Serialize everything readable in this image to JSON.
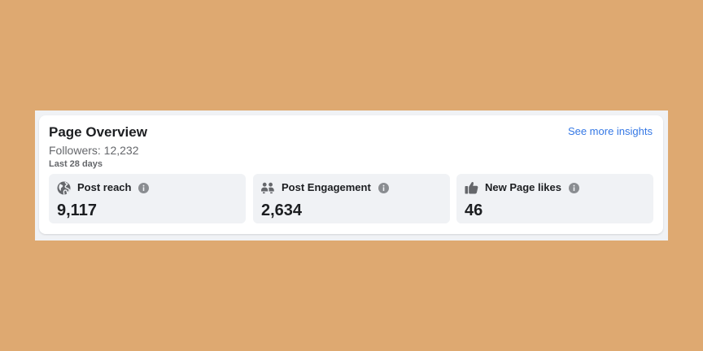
{
  "colors": {
    "background": "#DEA971",
    "card": "#FFFFFF",
    "tile": "#F0F2F5",
    "text_primary": "#1C1E21",
    "text_secondary": "#65676B",
    "link": "#3578E5",
    "icon": "#65676B"
  },
  "header": {
    "title": "Page Overview",
    "followers": "Followers: 12,232",
    "period": "Last 28 days",
    "see_more_label": "See more insights"
  },
  "metrics": [
    {
      "label": "Post reach",
      "value": "9,117",
      "icon": "globe-icon"
    },
    {
      "label": "Post Engagement",
      "value": "2,634",
      "icon": "people-icon"
    },
    {
      "label": "New Page likes",
      "value": "46",
      "icon": "thumbs-up-icon"
    }
  ]
}
